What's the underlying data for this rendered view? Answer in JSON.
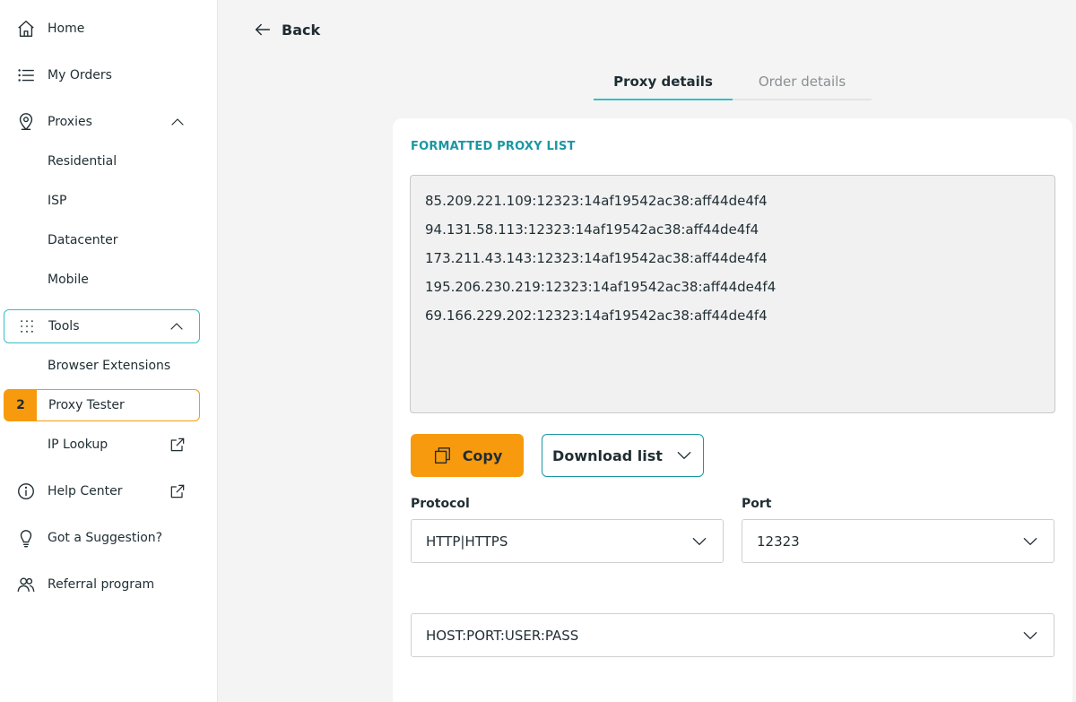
{
  "sidebar": {
    "home": "Home",
    "my_orders": "My Orders",
    "proxies": "Proxies",
    "proxy_sub": [
      "Residential",
      "ISP",
      "Datacenter",
      "Mobile"
    ],
    "tools": "Tools",
    "browser_extensions": "Browser Extensions",
    "proxy_tester": "Proxy Tester",
    "proxy_tester_badge": "2",
    "ip_lookup": "IP Lookup",
    "help_center": "Help Center",
    "suggestion": "Got a Suggestion?",
    "referral": "Referral program"
  },
  "header": {
    "back_label": "Back"
  },
  "tabs": {
    "proxy_details": "Proxy details",
    "order_details": "Order details",
    "active": "proxy_details"
  },
  "card": {
    "title": "FORMATTED PROXY LIST",
    "proxies": [
      "85.209.221.109:12323:14af19542ac38:aff44de4f4",
      "94.131.58.113:12323:14af19542ac38:aff44de4f4",
      "173.211.43.143:12323:14af19542ac38:aff44de4f4",
      "195.206.230.219:12323:14af19542ac38:aff44de4f4",
      "69.166.229.202:12323:14af19542ac38:aff44de4f4"
    ],
    "copy_label": "Copy",
    "download_label": "Download list",
    "protocol_label": "Protocol",
    "protocol_value": "HTTP|HTTPS",
    "port_label": "Port",
    "port_value": "12323",
    "format_value": "HOST:PORT:USER:PASS"
  },
  "colors": {
    "accent_teal": "#33bfc7",
    "accent_orange": "#f79a0e",
    "title_teal": "#1a97a3"
  }
}
